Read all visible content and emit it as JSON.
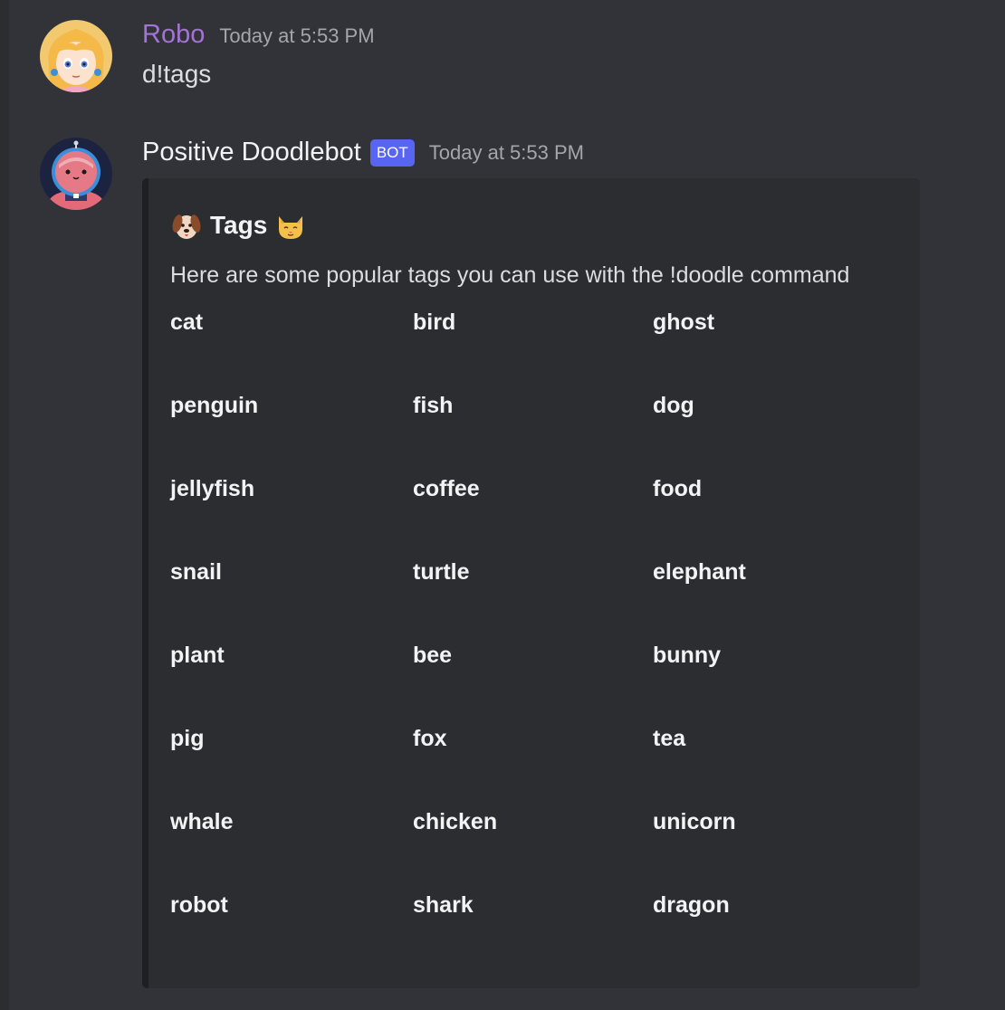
{
  "messages": [
    {
      "username": "Robo",
      "timestamp": "Today at 5:53 PM",
      "content": "d!tags"
    },
    {
      "username": "Positive Doodlebot",
      "badge": "BOT",
      "timestamp": "Today at 5:53 PM",
      "embed": {
        "title": "Tags",
        "title_icons": [
          "dog-face-icon",
          "cat-face-icon"
        ],
        "description": "Here are some popular tags you can use with the !doodle command",
        "tags": [
          [
            "cat",
            "bird",
            "ghost"
          ],
          [
            "penguin",
            "fish",
            "dog"
          ],
          [
            "jellyfish",
            "coffee",
            "food"
          ],
          [
            "snail",
            "turtle",
            "elephant"
          ],
          [
            "plant",
            "bee",
            "bunny"
          ],
          [
            "pig",
            "fox",
            "tea"
          ],
          [
            "whale",
            "chicken",
            "unicorn"
          ],
          [
            "robot",
            "shark",
            "dragon"
          ]
        ]
      }
    }
  ],
  "colors": {
    "background": "#313338",
    "embed_background": "#2b2d31",
    "robo_name": "#a374d2",
    "bot_badge": "#5865f2",
    "timestamp": "#a3a6aa"
  }
}
